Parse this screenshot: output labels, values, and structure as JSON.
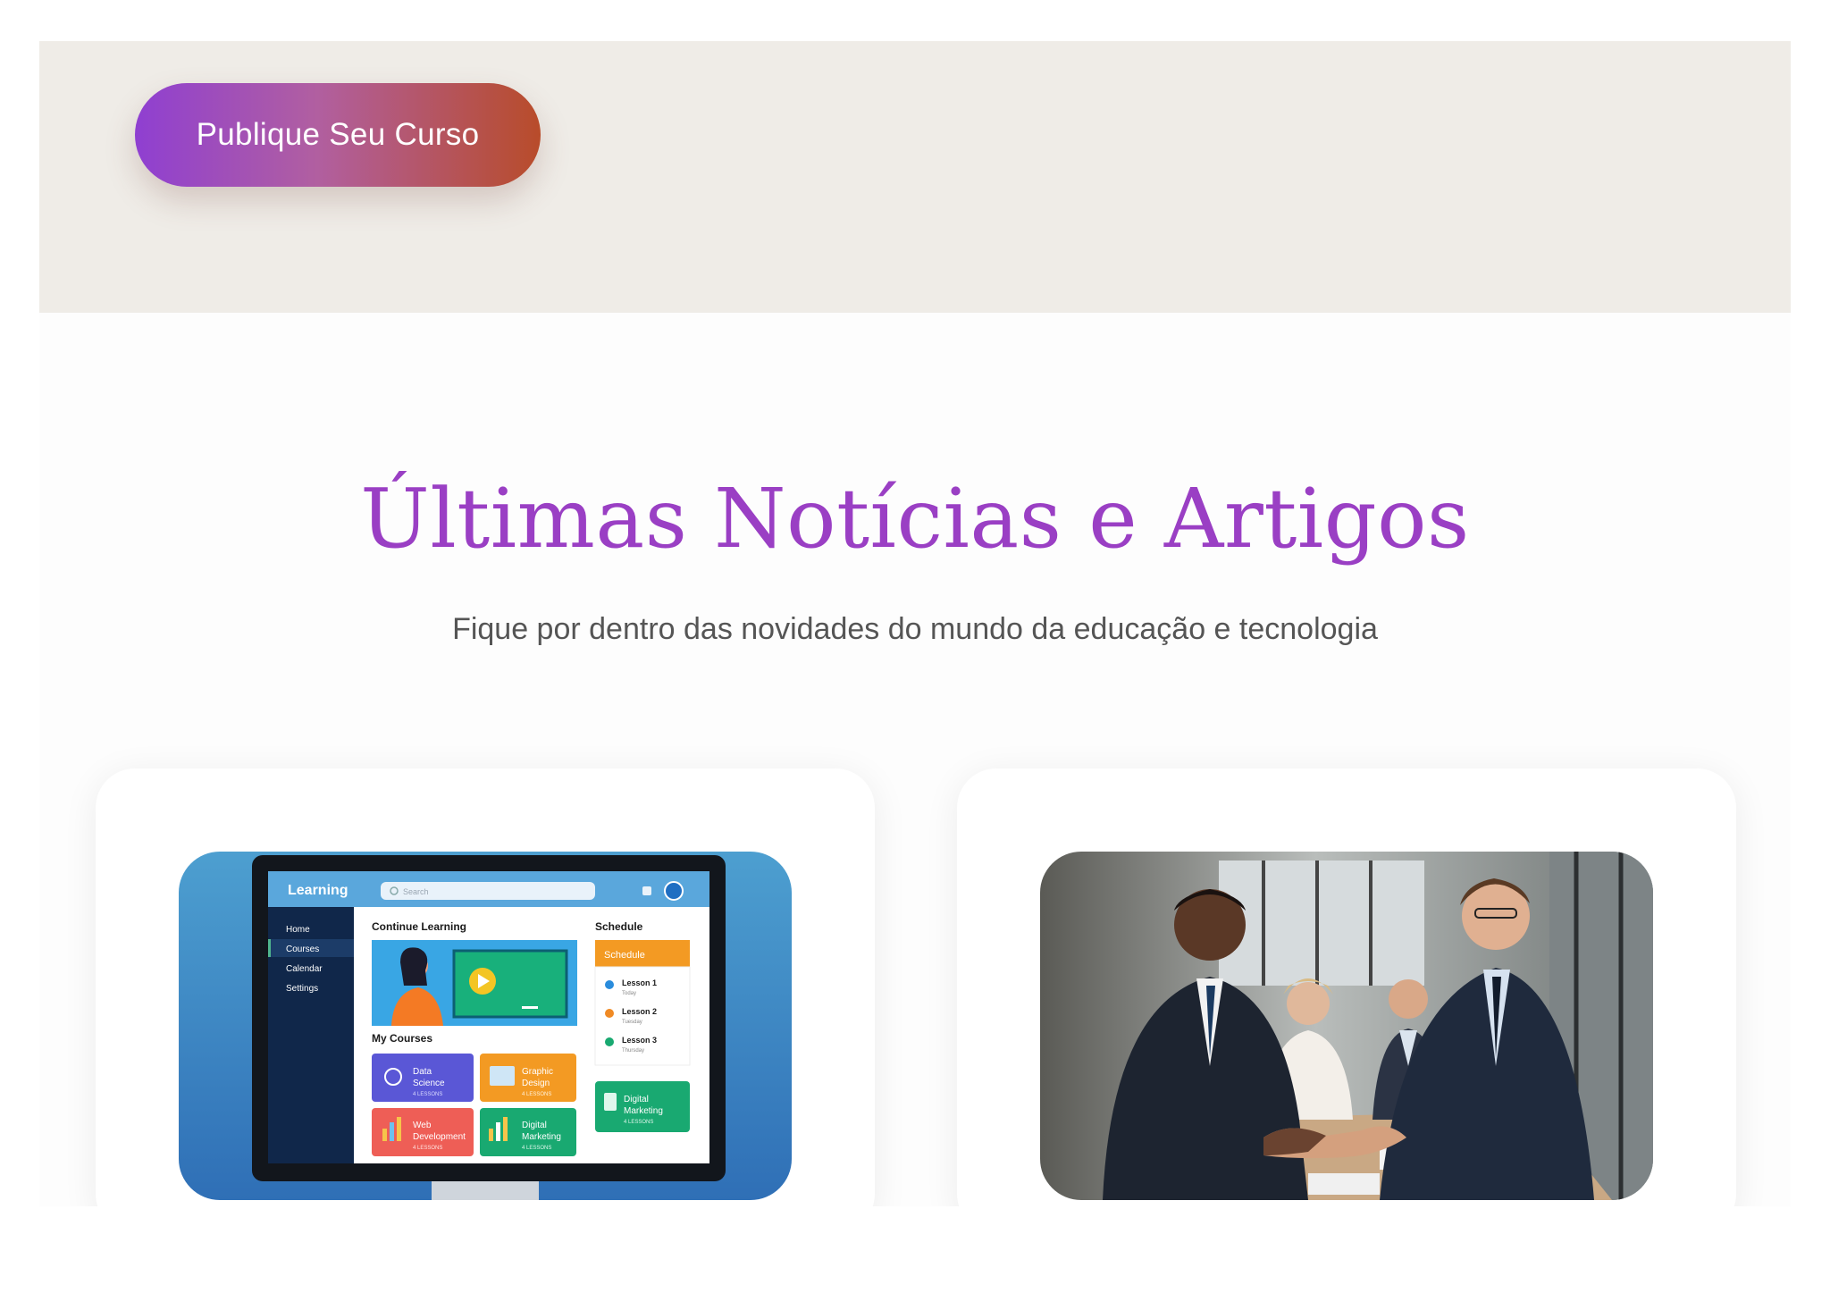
{
  "hero": {
    "cta_label": "Publique Seu Curso"
  },
  "news": {
    "title": "Últimas Notícias e Artigos",
    "subtitle": "Fique por dentro das novidades do mundo da educação e tecnologia"
  },
  "articles": [
    {
      "image": {
        "app_title": "Learning",
        "search_placeholder": "Search",
        "sidebar": [
          "Home",
          "Courses",
          "Calendar",
          "Settings"
        ],
        "continue_label": "Continue Learning",
        "my_courses_label": "My Courses",
        "courses": [
          {
            "name": "Data",
            "name2": "Science",
            "meta": "4 LESSONS"
          },
          {
            "name": "Graphic",
            "name2": "Design",
            "meta": "4 LESSONS"
          },
          {
            "name": "Web",
            "name2": "Development",
            "meta": "4 LESSONS"
          },
          {
            "name": "Digital",
            "name2": "Marketing",
            "meta": "4 LESSONS"
          }
        ],
        "schedule_heading": "Schedule",
        "schedule_tab": "Schedule",
        "lessons": [
          {
            "name": "Lesson 1",
            "day": "Today"
          },
          {
            "name": "Lesson 2",
            "day": "Tuesday"
          },
          {
            "name": "Lesson 3",
            "day": "Thursday"
          }
        ],
        "extra_course": {
          "name": "Digital",
          "name2": "Marketing",
          "meta": "4 LESSONS"
        }
      }
    },
    {
      "image": {}
    }
  ],
  "colors": {
    "accent_purple": "#9a3fc4",
    "cta_start": "#8f3fd1",
    "cta_end": "#b84c2a",
    "hero_band": "#efece7"
  }
}
